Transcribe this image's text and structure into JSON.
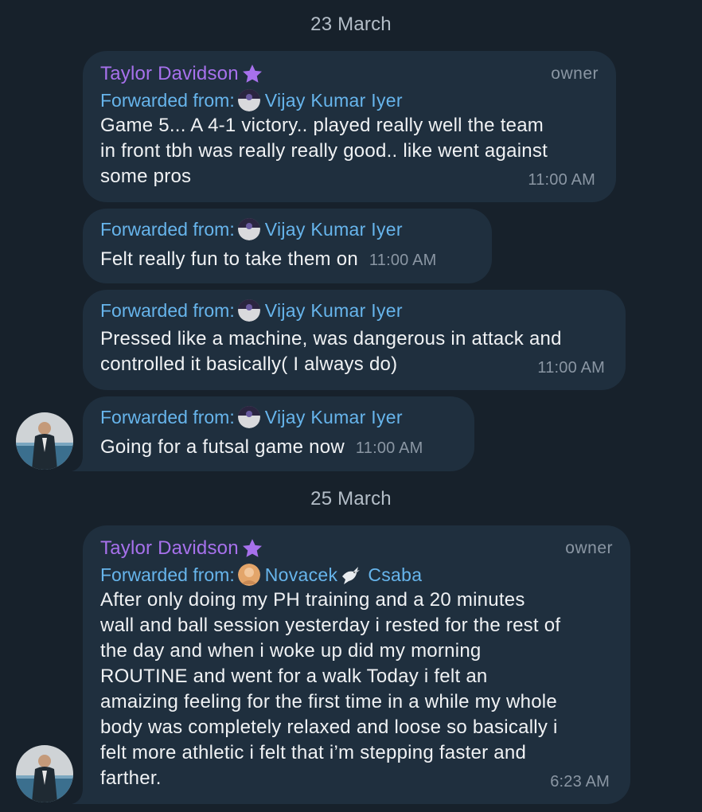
{
  "colors": {
    "background": "#17212b",
    "bubble": "#1f2f3e",
    "sender_name": "#a771ec",
    "forward_link": "#67b5ec",
    "meta_text": "#8a96a3"
  },
  "dates": [
    "23 March",
    "25 March"
  ],
  "messages": [
    {
      "sender": "Taylor Davidson",
      "sender_badge_icon": "star-icon",
      "role": "owner",
      "forwarded_label": "Forwarded from:",
      "forwarded_name": "Vijay Kumar Iyer",
      "text": "Game 5... A 4-1 victory.. played really well the team\nin front tbh was really really good.. like went against\nsome pros",
      "time": "11:00 AM"
    },
    {
      "forwarded_label": "Forwarded from:",
      "forwarded_name": "Vijay Kumar Iyer",
      "text": "Felt really fun to take them on",
      "time": "11:00 AM"
    },
    {
      "forwarded_label": "Forwarded from:",
      "forwarded_name": "Vijay Kumar Iyer",
      "text": "Pressed like a machine, was dangerous in attack and\ncontrolled it basically( I always do)",
      "time": "11:00 AM"
    },
    {
      "forwarded_label": "Forwarded from:",
      "forwarded_name": "Vijay Kumar Iyer",
      "text": "Going for a futsal game now",
      "time": "11:00 AM"
    },
    {
      "sender": "Taylor Davidson",
      "sender_badge_icon": "star-icon",
      "role": "owner",
      "forwarded_label": "Forwarded from:",
      "forwarded_name_first": "Novacek",
      "forwarded_name_emoji_icon": "dove-icon",
      "forwarded_name_last": "Csaba",
      "text": "After only doing my PH training and a 20 minutes\nwall and ball session yesterday i rested for the rest of\nthe day and when i woke up did my morning\nROUTINE and went for a walk Today i felt an\namaizing feeling for the first time in a while my whole\nbody was completely relaxed and loose so basically i\nfelt more athletic i felt that i’m stepping faster and\nfarther.",
      "time": "6:23 AM"
    }
  ]
}
